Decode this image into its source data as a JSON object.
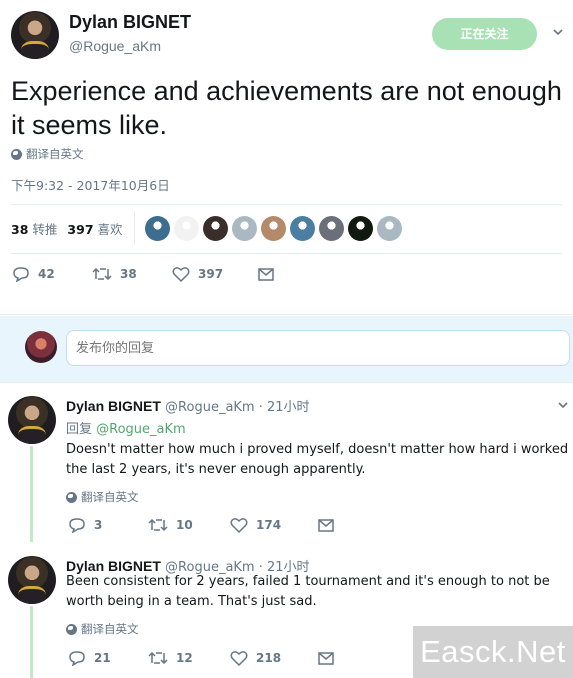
{
  "tweet": {
    "display_name": "Dylan BIGNET",
    "handle": "@Rogue_aKm",
    "follow_label": "正在关注",
    "text": "Experience and achievements are not enough it seems like.",
    "translate_label": "翻译自英文",
    "timestamp": "下午9:32 - 2017年10月6日",
    "retweets_count": "38",
    "retweets_label": "转推",
    "likes_count": "397",
    "likes_label": "喜欢",
    "liker_avatar_colors": [
      "#3d6e8f",
      "#f2f2f2",
      "#3a2e2a",
      "#aab8c2",
      "#b58a6a",
      "#4a7fa3",
      "#6a6f7a",
      "#101a10",
      "#aab8c2"
    ],
    "actions": {
      "replies": "42",
      "retweets": "38",
      "likes": "397"
    }
  },
  "reply_box": {
    "placeholder": "发布你的回复"
  },
  "replies": [
    {
      "display_name": "Dylan BIGNET",
      "handle": "@Rogue_aKm",
      "time": "· 21小时",
      "replying_to_label": "回复",
      "replying_to_handle": "@Rogue_aKm",
      "text": "Doesn't matter how much i proved myself, doesn't matter how hard i worked the last 2 years, it's never enough apparently.",
      "translate_label": "翻译自英文",
      "actions": {
        "replies": "3",
        "retweets": "10",
        "likes": "174"
      }
    },
    {
      "display_name": "Dylan BIGNET",
      "handle": "@Rogue_aKm",
      "time": "· 21小时",
      "text": "Been consistent for 2 years, failed 1 tournament and it's enough to not be worth being in a team. That's just sad.",
      "translate_label": "翻译自英文",
      "actions": {
        "replies": "21",
        "retweets": "12",
        "likes": "218"
      }
    }
  ],
  "watermark": "Easck.Net",
  "colors": {
    "accent_green": "#4fa96b",
    "follow_button": "#a8e1b4",
    "muted": "#657786",
    "reply_bar": "#e8f5fd"
  }
}
